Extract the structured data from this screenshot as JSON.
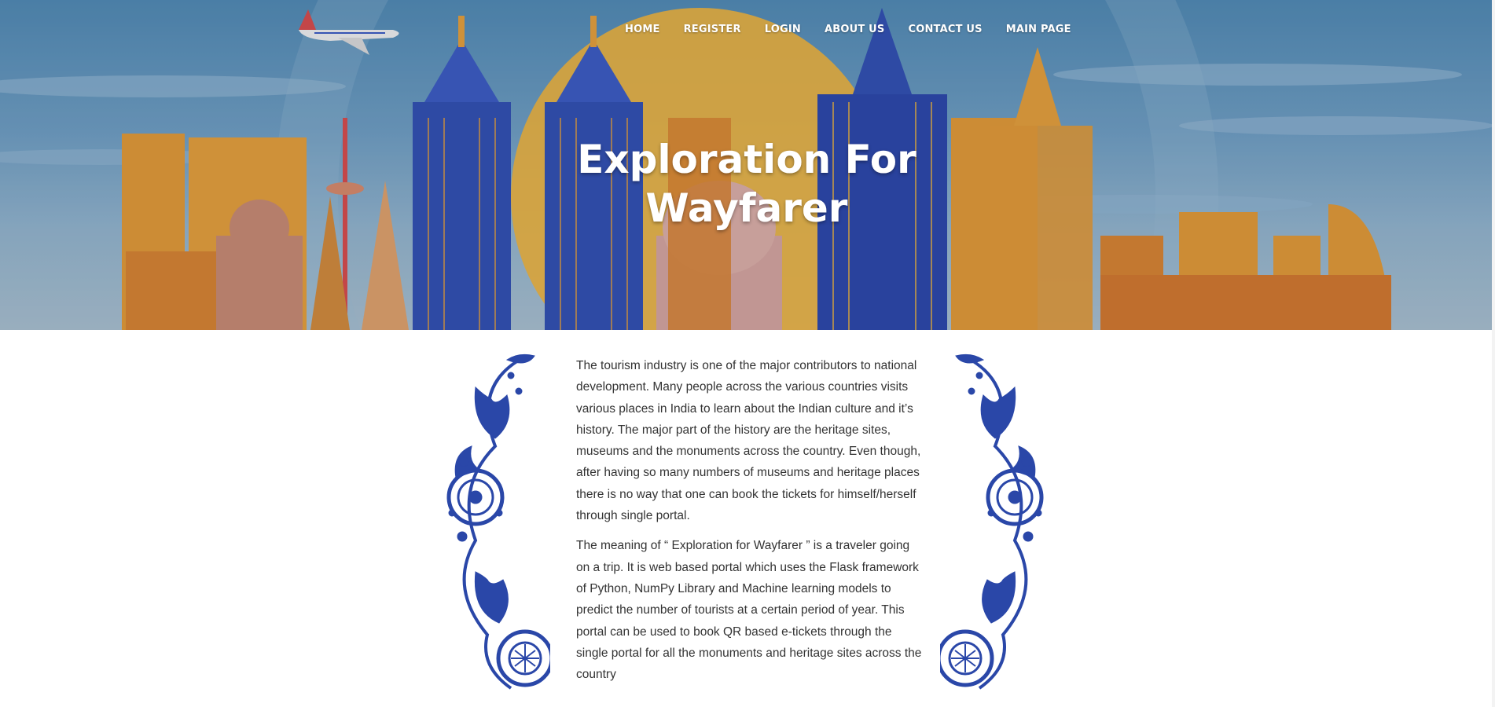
{
  "nav": {
    "items": [
      "HOME",
      "REGISTER",
      "LOGIN",
      "ABOUT US",
      "CONTACT US",
      "MAIN PAGE"
    ]
  },
  "hero": {
    "title_line1": "Exploration For",
    "title_line2": "Wayfarer"
  },
  "content": {
    "paragraph1": "The tourism industry is one of the major contributors to national development. Many people across the various countries visits various places in India to learn about the Indian culture and it’s history. The major part of the history are the heritage sites, museums and the monuments across the country. Even though, after having so many numbers of museums and heritage places there is no way that one can book the tickets for himself/herself through single portal.",
    "paragraph2": "The meaning of “ Exploration for Wayfarer ” is a traveler going on a trip. It is web based portal which uses the Flask framework of Python, NumPy Library and Machine learning models to predict the number of tourists at a certain period of year. This portal can be used to book QR based e-tickets through the single portal for all the monuments and heritage sites across the country"
  },
  "colors": {
    "sky": "#5b93bd",
    "sun": "#f2b53a",
    "building_orange": "#e39a35",
    "building_blue": "#2f4fb3",
    "ornament_blue": "#2a47a8",
    "text": "#333333"
  },
  "icons": [
    "airplane-icon",
    "floral-ornament-left",
    "floral-ornament-right"
  ]
}
